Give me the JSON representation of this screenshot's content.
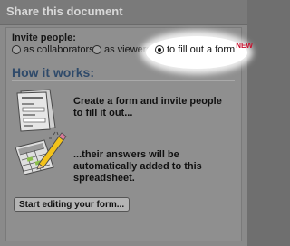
{
  "dialog": {
    "title": "Share this document"
  },
  "invite": {
    "label": "Invite people:",
    "options": [
      {
        "label": "as collaborators",
        "selected": false
      },
      {
        "label": "as viewers",
        "selected": false
      },
      {
        "label": "to fill out a form",
        "selected": true,
        "badge": "NEW"
      }
    ]
  },
  "how": {
    "heading": "How it works:",
    "steps": [
      {
        "text": "Create a form and invite people to fill it out...",
        "icon": "form-document-icon"
      },
      {
        "text": "...their answers will be automatically added to this spreadsheet.",
        "icon": "spreadsheet-pencil-icon"
      }
    ]
  },
  "actions": {
    "start_label": "Start editing your form..."
  },
  "colors": {
    "heading": "#2f4a6a",
    "badge": "#c8102e"
  }
}
